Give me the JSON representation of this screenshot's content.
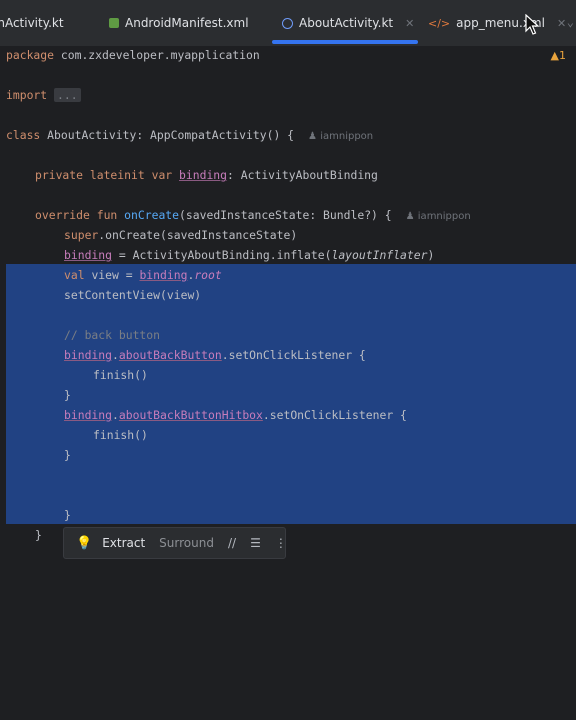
{
  "tabs": [
    {
      "label": "inActivity.kt",
      "icon": "kotlin-file-icon",
      "active": false
    },
    {
      "label": "AndroidManifest.xml",
      "icon": "manifest-file-icon",
      "active": false
    },
    {
      "label": "AboutActivity.kt",
      "icon": "kotlin-class-icon",
      "active": true
    },
    {
      "label": "app_menu.xml",
      "icon": "xml-file-icon",
      "active": false
    }
  ],
  "colors": {
    "accent": "#3574f0",
    "selection": "#214283",
    "background": "#1e1f22"
  },
  "editor": {
    "warning_count": "1",
    "code": {
      "l1_kw": "package ",
      "l1_pkg": "com.zxdeveloper.myapplication",
      "l2_kw": "import ",
      "l2_fold": "...",
      "l3_kw": "class ",
      "l3_name": "AboutActivity",
      "l3_rest": ": AppCompatActivity() {",
      "l3_author": "iamnippon",
      "l4_kw": "private lateinit var ",
      "l4_prop": "binding",
      "l4_rest": ": ActivityAboutBinding",
      "l5_kw": "override fun ",
      "l5_fn": "onCreate",
      "l5_rest": "(savedInstanceState: Bundle?) {",
      "l5_author": "iamnippon",
      "l6_kw": "super",
      "l6_rest": ".onCreate(savedInstanceState)",
      "l7_prop": "binding",
      "l7_mid": " = ActivityAboutBinding.inflate(",
      "l7_arg": "layoutInflater",
      "l7_end": ")",
      "l8_kw": "val ",
      "l8_mid": "view = ",
      "l8_prop": "binding",
      "l8_dot": ".",
      "l8_root": "root",
      "l9": "setContentView(view)",
      "l10": "// back button",
      "l11_prop": "binding",
      "l11_dot": ".",
      "l11_prop2": "aboutBackButton",
      "l11_rest": ".setOnClickListener {",
      "l12": "finish()",
      "l13": "}",
      "l14_prop": "binding",
      "l14_dot": ".",
      "l14_prop2": "aboutBackButtonHitbox",
      "l14_rest": ".setOnClickListener {",
      "l15": "finish()",
      "l16": "}",
      "l17": "}",
      "l18": "}"
    }
  },
  "intention_bar": {
    "extract_label": "Extract",
    "surround_label": "Surround",
    "comment_icon_label": "//",
    "format_icon": "format-lines-icon",
    "more_icon": "more-vertical-icon"
  }
}
